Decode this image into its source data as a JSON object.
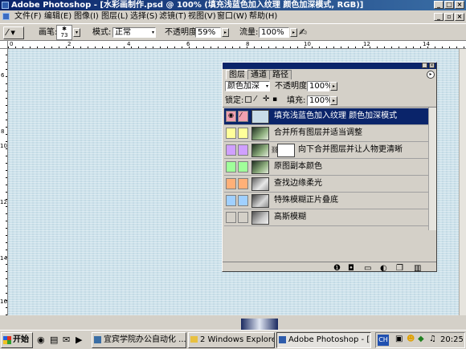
{
  "window": {
    "title": "Adobe Photoshop - [水彩画制作.psd @ 100% (填充浅蓝色加入纹理 颜色加深模式, RGB)]"
  },
  "menu": [
    "文件(F)",
    "编辑(E)",
    "图像(I)",
    "图层(L)",
    "选择(S)",
    "滤镜(T)",
    "视图(V)",
    "窗口(W)",
    "帮助(H)"
  ],
  "options": {
    "brush_label": "画笔:",
    "brush_size": "73",
    "mode_label": "模式:",
    "mode_value": "正常",
    "opacity_label": "不透明度:",
    "opacity_value": "59%",
    "flow_label": "流量:",
    "flow_value": "100%"
  },
  "rulers": {
    "top": [
      "0",
      "2",
      "4",
      "6",
      "8",
      "10",
      "12",
      "14"
    ],
    "left": [
      "6",
      "8",
      "10",
      "12",
      "14",
      "16"
    ]
  },
  "layers_panel": {
    "tabs": [
      "图层",
      "通道",
      "路径"
    ],
    "blend_mode": "颜色加深",
    "opacity_label": "不透明度:",
    "opacity_value": "100%",
    "lock_label": "锁定:",
    "fill_label": "填充:",
    "fill_value": "100%",
    "layers": [
      {
        "name": "填充浅蓝色加入纹理 颜色加深模式",
        "color": "#f0a0b0",
        "selected": true
      },
      {
        "name": "合并所有图层并适当调整",
        "color": "#ffff9a",
        "selected": false
      },
      {
        "name": "向下合并图层并让人物更清晰",
        "color": "#d0a0ff",
        "selected": false
      },
      {
        "name": "原图副本颜色",
        "color": "#a0ff9a",
        "selected": false
      },
      {
        "name": "查找边缘柔光",
        "color": "#ffb078",
        "selected": false
      },
      {
        "name": "特殊模糊正片叠底",
        "color": "#a0d0ff",
        "selected": false
      },
      {
        "name": "高斯模糊",
        "color": "#d4d0c8",
        "selected": false
      }
    ]
  },
  "taskbar": {
    "start": "开始",
    "items": [
      "宜宾学院办公自动化 ...",
      "2 Windows Explorer",
      "Adobe Photoshop - [水..."
    ],
    "ime": "CH",
    "time": "20:25"
  }
}
